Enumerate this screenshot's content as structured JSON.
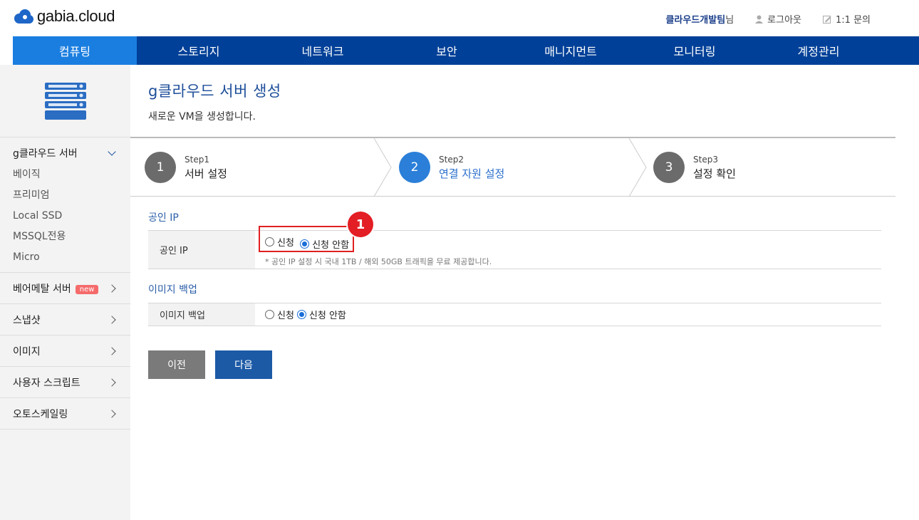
{
  "header": {
    "brand": "gabia.cloud",
    "team_name": "클라우드개발팀",
    "team_suffix": "님",
    "logout_label": "로그아웃",
    "inquiry_label": "1:1 문의"
  },
  "nav": {
    "items": [
      "컴퓨팅",
      "스토리지",
      "네트워크",
      "보안",
      "매니지먼트",
      "모니터링",
      "계정관리"
    ],
    "active_index": 0
  },
  "sidebar": {
    "open_section": "g클라우드 서버",
    "open_items": [
      "베이직",
      "프리미엄",
      "Local SSD",
      "MSSQL전용",
      "Micro"
    ],
    "sections": [
      {
        "label": "베어메탈 서버",
        "badge": "new"
      },
      {
        "label": "스냅샷"
      },
      {
        "label": "이미지"
      },
      {
        "label": "사용자 스크립트"
      },
      {
        "label": "오토스케일링"
      }
    ]
  },
  "page": {
    "title": "g클라우드 서버 생성",
    "description": "새로운 VM을 생성합니다."
  },
  "steps": [
    {
      "num": "1",
      "step": "Step1",
      "label": "서버 설정",
      "active": false
    },
    {
      "num": "2",
      "step": "Step2",
      "label": "연결 자원 설정",
      "active": true
    },
    {
      "num": "3",
      "step": "Step3",
      "label": "설정 확인",
      "active": false
    }
  ],
  "public_ip": {
    "section_title": "공인 IP",
    "row_label": "공인 IP",
    "option_apply": "신청",
    "option_no_apply": "신청 안함",
    "selected": "신청 안함",
    "note": "* 공인 IP 설정 시 국내 1TB / 해외 50GB 트래픽을 무료 제공합니다."
  },
  "image_backup": {
    "section_title": "이미지 백업",
    "row_label": "이미지 백업",
    "option_apply": "신청",
    "option_no_apply": "신청 안함",
    "selected": "신청 안함"
  },
  "annotation": {
    "marker": "1"
  },
  "buttons": {
    "prev": "이전",
    "next": "다음"
  },
  "colors": {
    "nav_bg": "#014098",
    "nav_active": "#1a7ee0",
    "accent": "#1c5aa6",
    "highlight": "#e02020"
  }
}
